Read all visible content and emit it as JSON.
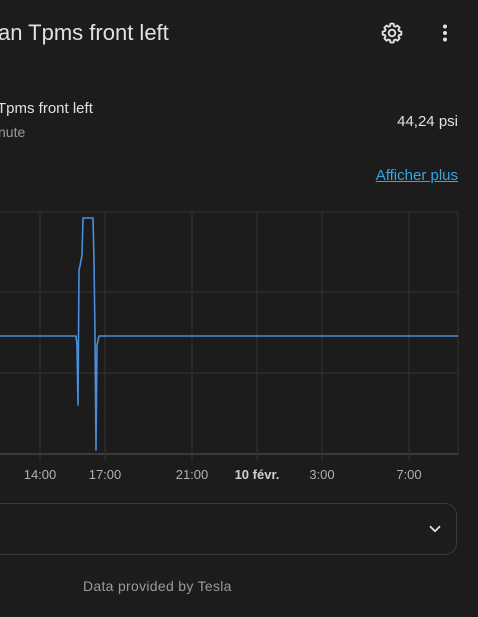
{
  "header": {
    "title": "an Tpms front left",
    "settings_icon": "gear-icon",
    "more_icon": "dots-vertical-icon"
  },
  "entity": {
    "name": "Tpms front left",
    "subtitle": "nute",
    "value": "44,24 psi"
  },
  "show_more_label": "Afficher plus",
  "chart_data": {
    "type": "line",
    "x_ticks": [
      "14:00",
      "17:00",
      "21:00",
      "10 févr.",
      "3:00",
      "7:00"
    ],
    "series": [
      {
        "color": "#4a8fd9",
        "points": [
          [
            "12:00",
            44.24
          ],
          [
            "15:45",
            44.24
          ],
          [
            "15:47",
            43.4
          ],
          [
            "15:49",
            45.0
          ],
          [
            "16:00",
            46.5
          ],
          [
            "16:10",
            46.5
          ],
          [
            "16:15",
            44.1
          ],
          [
            "16:18",
            44.24
          ],
          [
            "09:00",
            44.24
          ]
        ]
      }
    ],
    "grid": true
  },
  "expander": {
    "chevron_icon": "chevron-down-icon"
  },
  "attribution": "Data provided by Tesla"
}
